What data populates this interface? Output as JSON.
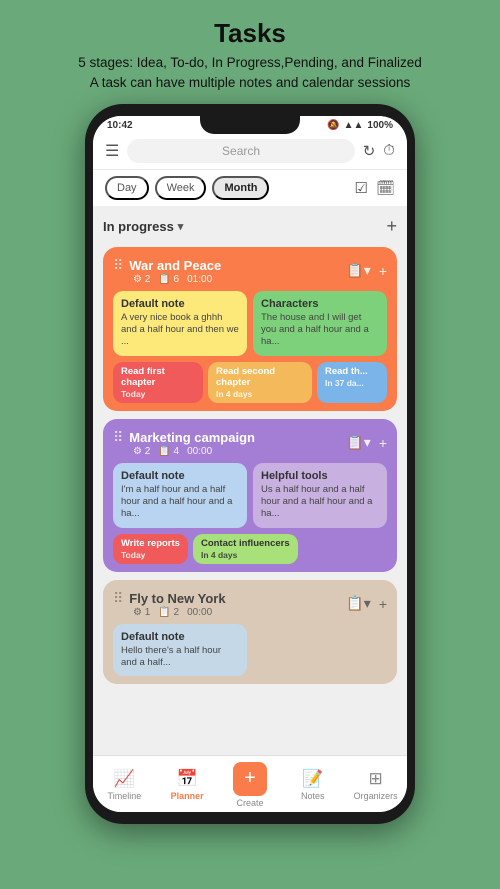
{
  "header": {
    "title": "Tasks",
    "subtitle_line1": "5 stages: Idea, To-do, In Progress,Pending, and Finalized",
    "subtitle_line2": "A task can have multiple notes and calendar sessions"
  },
  "status_bar": {
    "time": "10:42",
    "battery": "100%"
  },
  "top_bar": {
    "search_placeholder": "Search",
    "refresh_icon": "↻",
    "timer_icon": "⏱"
  },
  "view_tabs": {
    "tabs": [
      {
        "label": "Day",
        "active": false
      },
      {
        "label": "Week",
        "active": false
      },
      {
        "label": "Month",
        "active": true
      }
    ],
    "check_icon": "☑",
    "calendar_icon": "📅"
  },
  "section": {
    "label": "In progress",
    "add_label": "+"
  },
  "tasks": [
    {
      "id": "war-peace",
      "name": "War and Peace",
      "meta_tasks": "2",
      "meta_notes": "6",
      "meta_time": "01:00",
      "color": "orange",
      "notes": [
        {
          "title": "Default note",
          "body": "A very nice book a ghhh and a half hour and then we ...",
          "color": "yellow"
        },
        {
          "title": "Characters",
          "body": "The house and I will get you and a half hour and a ha...",
          "color": "green"
        }
      ],
      "sessions": [
        {
          "label": "Read first chapter",
          "date": "Today",
          "color": "red"
        },
        {
          "label": "Read second chapter",
          "date": "In 4 days",
          "color": "orange-light"
        },
        {
          "label": "Read th...",
          "date": "In 37 da...",
          "color": "blue"
        }
      ]
    },
    {
      "id": "marketing",
      "name": "Marketing campaign",
      "meta_tasks": "2",
      "meta_notes": "4",
      "meta_time": "00:00",
      "color": "purple",
      "notes": [
        {
          "title": "Default note",
          "body": "I'm a half hour and a half hour and a half hour and a ha...",
          "color": "lt-blue"
        },
        {
          "title": "Helpful tools",
          "body": "Us a half hour and a half hour and a half hour and a ha...",
          "color": "lt-purple"
        }
      ],
      "sessions": [
        {
          "label": "Write reports",
          "date": "Today",
          "color": "red"
        },
        {
          "label": "Contact influencers",
          "date": "In 4 days",
          "color": "lt-green"
        }
      ]
    },
    {
      "id": "fly-new-york",
      "name": "Fly to New York",
      "meta_tasks": "1",
      "meta_notes": "2",
      "meta_time": "00:00",
      "color": "beige",
      "notes": [
        {
          "title": "Default note",
          "body": "Hello there's a half hour and a half...",
          "color": "blue-gray"
        }
      ],
      "sessions": []
    }
  ],
  "bottom_nav": {
    "items": [
      {
        "label": "Timeline",
        "icon": "📈",
        "active": false
      },
      {
        "label": "Planner",
        "icon": "📅",
        "active": true
      },
      {
        "label": "Create",
        "icon": "+",
        "is_create": true
      },
      {
        "label": "Notes",
        "icon": "📝",
        "active": false
      },
      {
        "label": "Organizers",
        "icon": "⊞",
        "active": false
      }
    ]
  }
}
